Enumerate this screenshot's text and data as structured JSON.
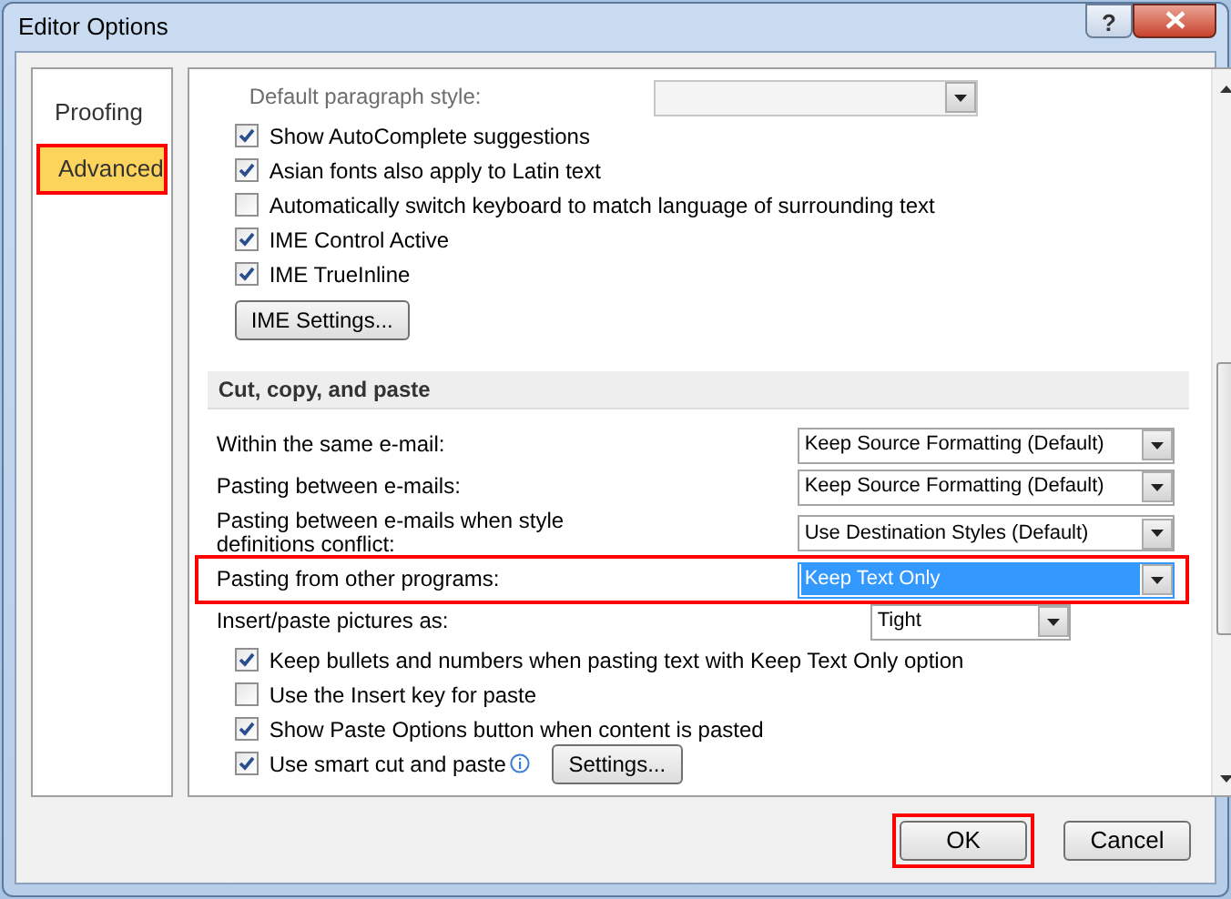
{
  "window": {
    "title": "Editor Options",
    "help_button": "?"
  },
  "sidebar": {
    "items": [
      {
        "label": "Proofing",
        "selected": false,
        "highlighted": false
      },
      {
        "label": "Advanced",
        "selected": true,
        "highlighted": true
      }
    ]
  },
  "items": [
    {
      "kind": "select",
      "label": "Default paragraph style:",
      "value": "",
      "disabled": true,
      "highlighted": false,
      "selected": false
    },
    {
      "kind": "checkbox",
      "label": "Show AutoComplete suggestions",
      "checked": true
    },
    {
      "kind": "checkbox",
      "label": "Asian fonts also apply to Latin text",
      "checked": true
    },
    {
      "kind": "checkbox",
      "label": "Automatically switch keyboard to match language of surrounding text",
      "checked": false
    },
    {
      "kind": "checkbox",
      "label": "IME Control Active",
      "checked": true
    },
    {
      "kind": "checkbox",
      "label": "IME TrueInline",
      "checked": true
    },
    {
      "kind": "button",
      "label": "IME Settings..."
    },
    {
      "kind": "heading",
      "label": "Cut, copy, and paste"
    },
    {
      "kind": "select",
      "label": "Within the same e-mail:",
      "value": "Keep Source Formatting (Default)",
      "disabled": false,
      "highlighted": false,
      "selected": false
    },
    {
      "kind": "select",
      "label": "Pasting between e-mails:",
      "value": "Keep Source Formatting (Default)",
      "disabled": false,
      "highlighted": false,
      "selected": false
    },
    {
      "kind": "select",
      "label": "Pasting between e-mails when style definitions conflict:",
      "value": "Use Destination Styles (Default)",
      "disabled": false,
      "highlighted": false,
      "selected": false
    },
    {
      "kind": "select",
      "label": "Pasting from other programs:",
      "value": "Keep Text Only",
      "disabled": false,
      "highlighted": true,
      "selected": true
    },
    {
      "kind": "select",
      "label": "Insert/paste pictures as:",
      "value": "Tight",
      "disabled": false,
      "highlighted": false,
      "selected": false,
      "narrow": true
    },
    {
      "kind": "checkbox",
      "label": "Keep bullets and numbers when pasting text with Keep Text Only option",
      "checked": true
    },
    {
      "kind": "checkbox",
      "label": "Use the Insert key for paste",
      "checked": false
    },
    {
      "kind": "checkbox",
      "label": "Show Paste Options button when content is pasted",
      "checked": true
    },
    {
      "kind": "checkbox",
      "label": "Use smart cut and paste",
      "checked": true,
      "info": true,
      "button": "Settings..."
    }
  ],
  "buttons": [
    {
      "label": "OK",
      "highlighted": true
    },
    {
      "label": "Cancel",
      "highlighted": false
    }
  ]
}
